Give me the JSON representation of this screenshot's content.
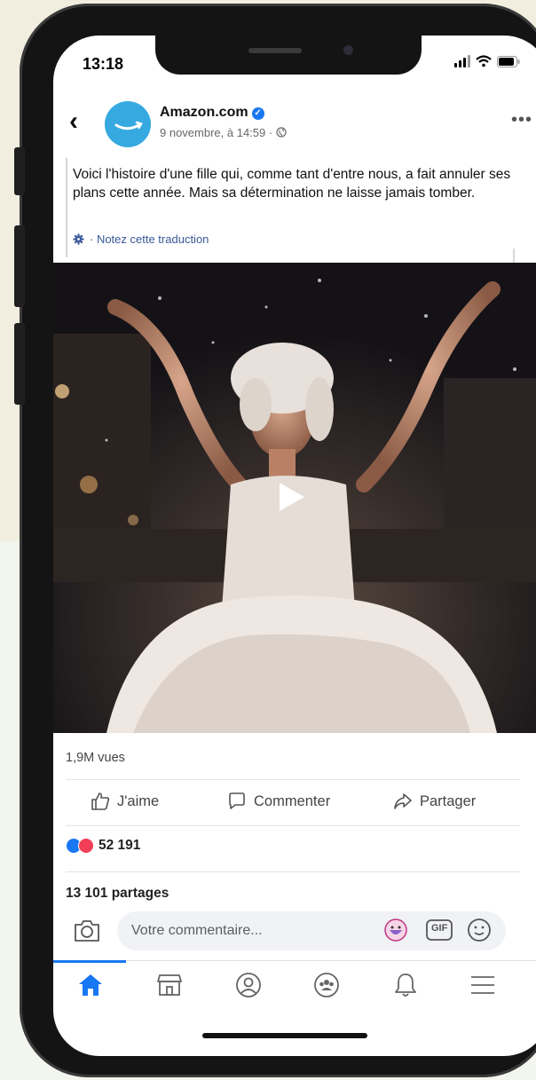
{
  "status": {
    "time": "13:18"
  },
  "post": {
    "page_name": "Amazon.com",
    "date": "9 novembre, à 14:59 ·",
    "text": "Voici l'histoire d'une fille qui, comme tant d'entre nous, a fait annuler ses plans cette année. Mais sa détermination ne laisse jamais tomber.",
    "rate_translation": "· Notez cette traduction",
    "views": "1,9M vues",
    "reactions_count": "52 191",
    "shares": "13 101 partages"
  },
  "actions": {
    "like": "J'aime",
    "comment": "Commenter",
    "share": "Partager"
  },
  "comment": {
    "placeholder": "Votre commentaire..."
  },
  "icons": {
    "gif_label": "GIF"
  },
  "colors": {
    "accent": "#1877f2",
    "love": "#f33e58",
    "link": "#385898"
  }
}
